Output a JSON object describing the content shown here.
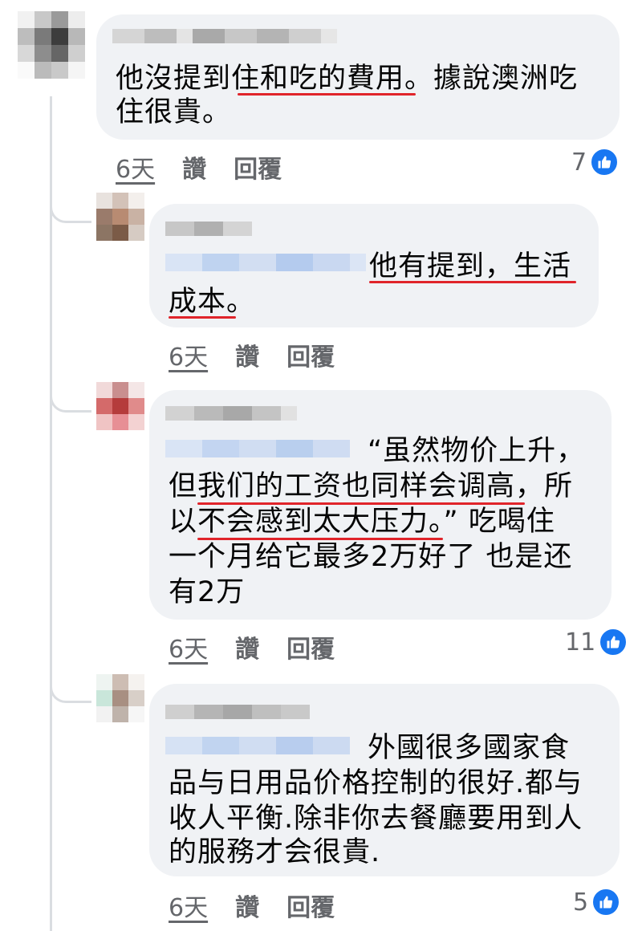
{
  "actions": {
    "like_label": "讚",
    "reply_label": "回覆"
  },
  "comments": [
    {
      "lines": [
        "他沒提到住和吃的費用。據說澳洲吃",
        "住很貴。"
      ],
      "time": "6天",
      "reaction_count": "7"
    },
    {
      "lines": [
        "他有提到，生活",
        "成本。"
      ],
      "time": "6天",
      "reaction_count": ""
    },
    {
      "lines": [
        "“虽然物价上升，",
        "但我们的工资也同样会调高，所",
        "以不会感到太大压力。” 吃喝住",
        "一个月给它最多2万好了 也是还",
        "有2万"
      ],
      "time": "6天",
      "reaction_count": "11"
    },
    {
      "lines": [
        "外國很多國家食",
        "品与日用品价格控制的很好.都与",
        "收人平衡.除非你去餐廳要用到人",
        "的服務才会很貴."
      ],
      "time": "6天",
      "reaction_count": "5"
    }
  ],
  "icons": {
    "like_reaction": "thumbs-up-icon",
    "accent_color": "#1877f2",
    "underline_color": "#e0242a"
  }
}
